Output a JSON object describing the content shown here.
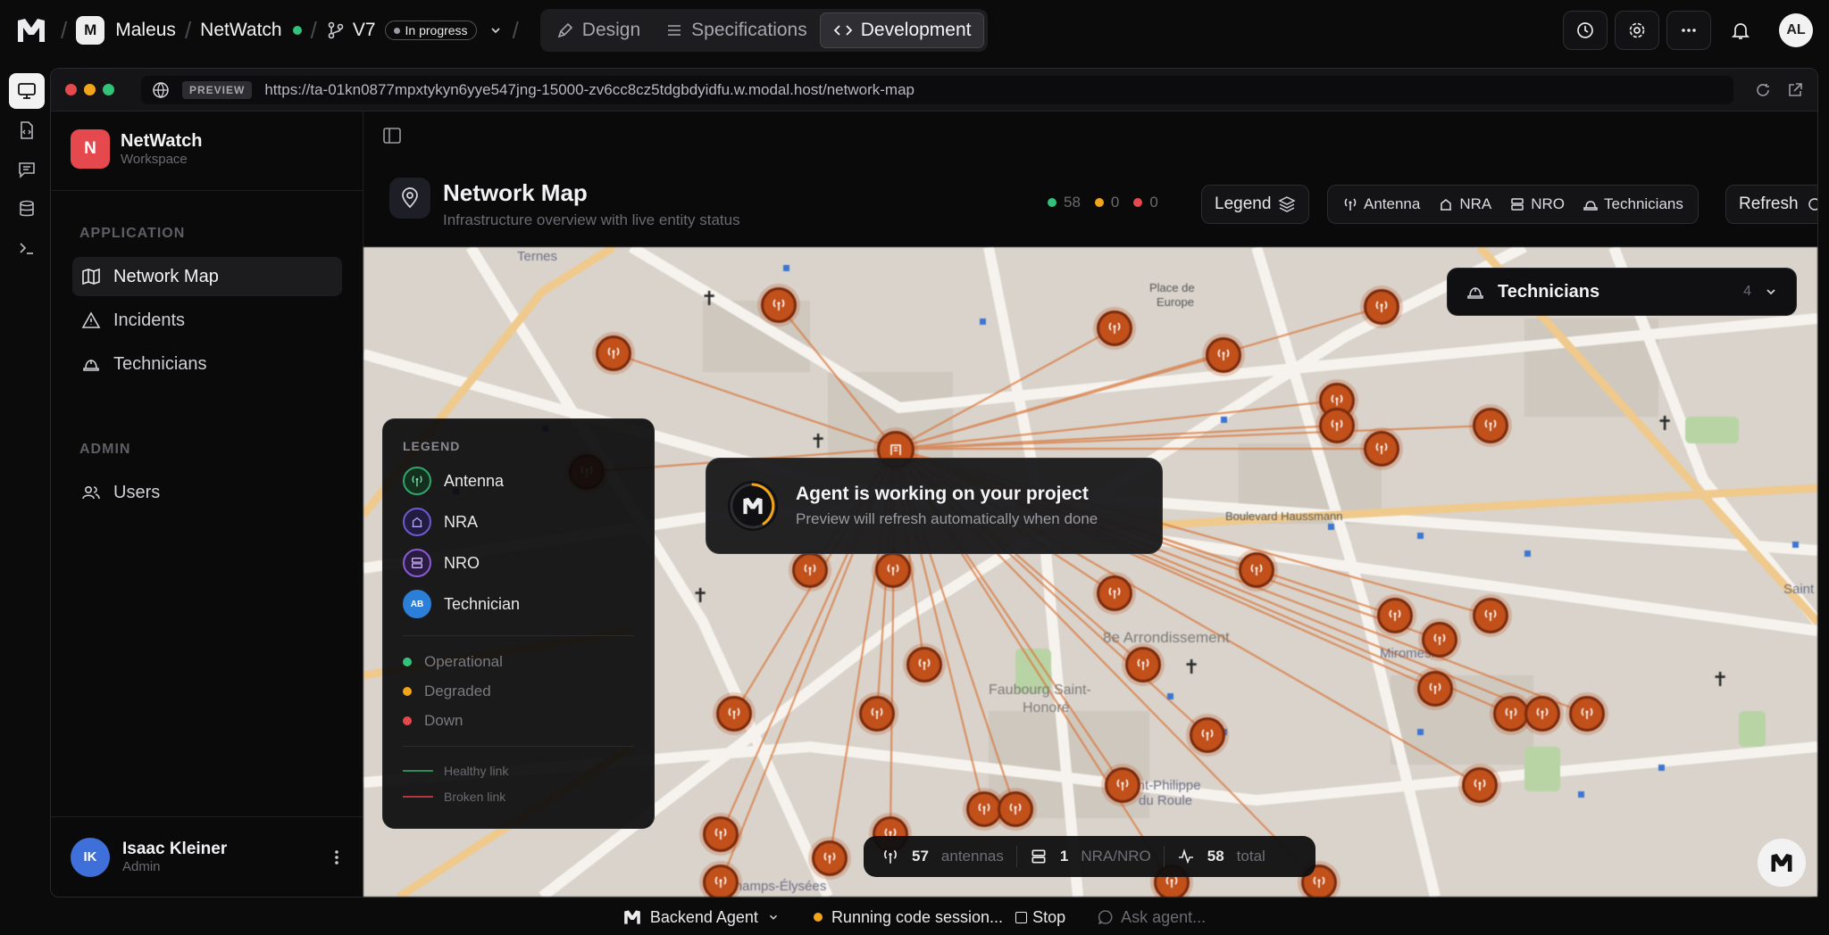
{
  "topbar": {
    "org": "Maleus",
    "org_initial": "M",
    "project": "NetWatch",
    "version": "V7",
    "version_status": "In progress",
    "tabs": [
      {
        "label": "Design"
      },
      {
        "label": "Specifications"
      },
      {
        "label": "Development"
      }
    ],
    "user_initials": "AL"
  },
  "preview": {
    "tag": "PREVIEW",
    "url": "https://ta-01kn0877mpxtykyn6yye547jng-15000-zv6cc8cz5tdgbdyidfu.w.modal.host/network-map"
  },
  "app": {
    "workspace_name": "NetWatch",
    "workspace_sub": "Workspace",
    "workspace_initial": "N",
    "section_app": "APPLICATION",
    "nav": [
      {
        "label": "Network Map"
      },
      {
        "label": "Incidents"
      },
      {
        "label": "Technicians"
      }
    ],
    "section_admin": "ADMIN",
    "admin_nav": [
      {
        "label": "Users"
      }
    ],
    "user": {
      "name": "Isaac Kleiner",
      "role": "Admin",
      "initials": "IK"
    }
  },
  "header": {
    "title": "Network Map",
    "subtitle": "Infrastructure overview with live entity status",
    "counts": {
      "ok": "58",
      "degraded": "0",
      "down": "0"
    },
    "legend_btn": "Legend",
    "filters": [
      "Antenna",
      "NRA",
      "NRO",
      "Technicians"
    ],
    "refresh_btn": "Refresh"
  },
  "map": {
    "labels": {
      "ternes": "Ternes",
      "place": "Place de",
      "europe": "Europe",
      "arrondissement": "8e Arrondissement",
      "faubourg1": "Faubourg Saint-",
      "faubourg2": "Honoré",
      "philippe1": "Saint-Philippe",
      "philippe2": "du Roule",
      "miromesnil": "Miromesnil",
      "haussmann": "Boulevard Haussmann",
      "elysees": "Champs-Élysées",
      "saint": "Saint"
    }
  },
  "legend": {
    "title": "LEGEND",
    "items": [
      {
        "label": "Antenna",
        "color": "#2fa66b"
      },
      {
        "label": "NRA",
        "color": "#6d5ccf"
      },
      {
        "label": "NRO",
        "color": "#8b5bd6"
      },
      {
        "label": "Technician",
        "color": "#2b7fd8",
        "badge": "AB"
      }
    ],
    "statuses": [
      {
        "label": "Operational",
        "color": "#33c27a"
      },
      {
        "label": "Degraded",
        "color": "#f2a51a"
      },
      {
        "label": "Down",
        "color": "#e5484d"
      }
    ],
    "links": [
      {
        "label": "Healthy link",
        "color": "#2f8a5a"
      },
      {
        "label": "Broken link",
        "color": "#b3383d"
      }
    ]
  },
  "toast": {
    "title": "Agent is working on your project",
    "subtitle": "Preview will refresh automatically when done"
  },
  "technicians_dd": {
    "label": "Technicians",
    "count": "4"
  },
  "stats": {
    "antennas": "57",
    "antennas_label": "antennas",
    "nra": "1",
    "nra_label": "NRA/NRO",
    "total": "58",
    "total_label": "total"
  },
  "bottombar": {
    "agent": "Backend Agent",
    "status": "Running code session...",
    "stop": "Stop",
    "ask_placeholder": "Ask agent..."
  }
}
